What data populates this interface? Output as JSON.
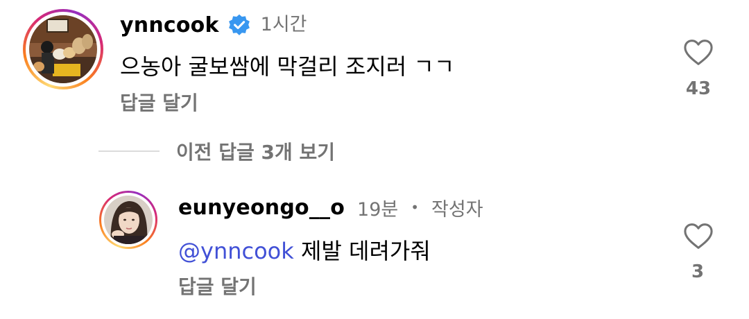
{
  "comments": [
    {
      "username": "ynncook",
      "verified": true,
      "time": "1시간",
      "text": "으농아 굴보쌈에 막걸리 조지러 ㄱㄱ",
      "reply_label": "답글 달기",
      "like_count": "43"
    }
  ],
  "replies_toggle": {
    "label": "이전 답글 3개 보기"
  },
  "replies": [
    {
      "username": "eunyeongo__o",
      "time": "19분",
      "separator": "•",
      "author_tag": "작성자",
      "mention": "@ynncook",
      "text": " 제발 데려가줘",
      "reply_label": "답글 달기",
      "like_count": "3"
    }
  ],
  "colors": {
    "verified": "#3897f0",
    "mention": "#4150d6",
    "secondary_text": "#737373"
  }
}
